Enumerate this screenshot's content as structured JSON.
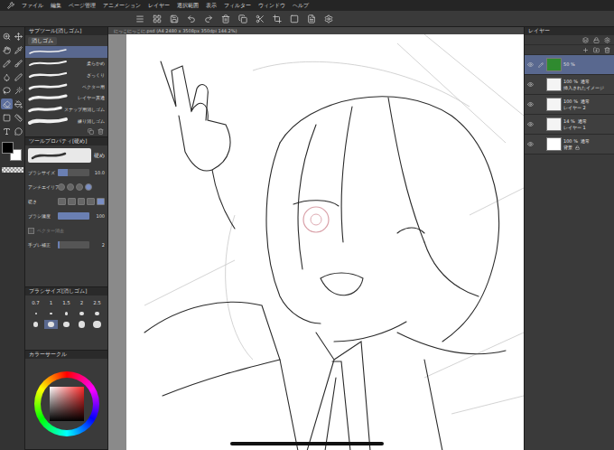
{
  "app_menu": [
    "ファイル",
    "編集",
    "ページ管理",
    "アニメーション",
    "レイヤー",
    "選択範囲",
    "表示",
    "フィルター",
    "ウィンドウ",
    "ヘルプ"
  ],
  "document_tab": {
    "title": "にっこにっこに.psd (A4 2480 x 3508px 350dpi 144.2%)"
  },
  "tool_column": {
    "tools": [
      {
        "selected": false
      },
      {
        "selected": false
      },
      {
        "selected": false
      },
      {
        "selected": false
      },
      {
        "selected": false
      },
      {
        "selected": false
      },
      {
        "selected": false
      },
      {
        "selected": false
      },
      {
        "selected": false
      },
      {
        "selected": false
      },
      {
        "selected": true
      },
      {
        "selected": false
      },
      {
        "selected": false
      },
      {
        "selected": false
      },
      {
        "selected": false
      },
      {
        "selected": false
      }
    ],
    "main_color": "#000000",
    "sub_color": "#ffffff"
  },
  "sub_tool": {
    "title": "サブツール[消しゴム]",
    "group": "消しゴム",
    "items": [
      {
        "label": "",
        "selected": true
      },
      {
        "label": "柔らかめ",
        "selected": false
      },
      {
        "label": "ざっくり",
        "selected": false
      },
      {
        "label": "ベクター用",
        "selected": false
      },
      {
        "label": "レイヤー貫通",
        "selected": false
      },
      {
        "label": "スナップ用消しゴム",
        "selected": false
      },
      {
        "label": "練り消しゴム",
        "selected": false
      }
    ]
  },
  "tool_property": {
    "title": "ツールプロパティ[硬め]",
    "preset": "硬め",
    "properties": [
      {
        "kind": "slider",
        "label": "ブラシサイズ",
        "value": "10.0",
        "level": 0.3
      },
      {
        "kind": "segments",
        "label": "アンチエイリアス",
        "options": [
          {
            "selected": false
          },
          {
            "selected": false
          },
          {
            "selected": false
          },
          {
            "selected": true
          }
        ]
      },
      {
        "kind": "segments",
        "label": "硬さ",
        "options": [
          {
            "selected": false
          },
          {
            "selected": false
          },
          {
            "selected": false
          },
          {
            "selected": false
          },
          {
            "selected": true
          }
        ]
      },
      {
        "kind": "slider",
        "label": "ブラシ濃度",
        "value": "100",
        "level": 1
      },
      {
        "kind": "toggle",
        "label": "ベクター消去",
        "disabled": true
      },
      {
        "kind": "slider",
        "label": "手ブレ補正",
        "value": "2",
        "level": 0.05
      }
    ]
  },
  "brush_size_panel": {
    "title": "ブラシサイズ[消しゴム]",
    "sizes": [
      "0.7",
      "1",
      "1.5",
      "2",
      "2.5"
    ],
    "presets": [
      {
        "selected": false
      },
      {
        "selected": false
      },
      {
        "selected": false
      },
      {
        "selected": false
      },
      {
        "selected": false
      },
      {
        "selected": false
      },
      {
        "selected": true
      },
      {
        "selected": false
      },
      {
        "selected": false
      },
      {
        "selected": false
      }
    ]
  },
  "color_panel": {
    "title": "カラーサークル",
    "hue": "#ff2a2a"
  },
  "layers": {
    "title": "レイヤー",
    "items": [
      {
        "opacity": "50 %",
        "mode": "",
        "name": "",
        "selected": true,
        "visible": true,
        "locked": false,
        "color": "#2f8a2f"
      },
      {
        "opacity": "100 %",
        "mode": "通常",
        "name": "挿入されたイメージ",
        "selected": false,
        "visible": true,
        "locked": false,
        "color": "#f4f4f4"
      },
      {
        "opacity": "100 %",
        "mode": "通常",
        "name": "レイヤー 2",
        "selected": false,
        "visible": true,
        "locked": false,
        "color": "#f4f4f4"
      },
      {
        "opacity": "14 %",
        "mode": "通常",
        "name": "レイヤー 1",
        "selected": false,
        "visible": true,
        "locked": false,
        "color": "#f4f4f4"
      },
      {
        "opacity": "100 %",
        "mode": "通常",
        "name": "背景",
        "selected": false,
        "visible": true,
        "locked": true,
        "color": "#ffffff"
      }
    ]
  }
}
